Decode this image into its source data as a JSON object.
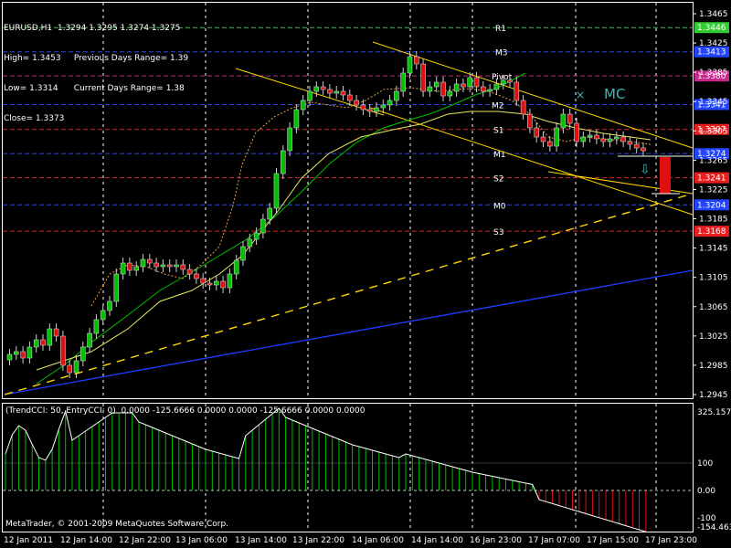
{
  "chart_data": {
    "type": "candlestick",
    "symbol_timeframe": "EURUSD,H1",
    "ohlc_header": "1.3294 1.3295 1.3274 1.3275",
    "price_axis_labels": [
      "1.3465",
      "1.3425",
      "1.3385",
      "1.3345",
      "1.3305",
      "1.3265",
      "1.3225",
      "1.3185",
      "1.3145",
      "1.3105",
      "1.3065",
      "1.3025",
      "1.2985",
      "1.2945"
    ],
    "time_axis_labels": [
      "12 Jan 2011",
      "12 Jan 14:00",
      "12 Jan 22:00",
      "13 Jan 06:00",
      "13 Jan 14:00",
      "13 Jan 22:00",
      "14 Jan 06:00",
      "14 Jan 14:00",
      "16 Jan 23:00",
      "17 Jan 07:00",
      "17 Jan 15:00",
      "17 Jan 23:00"
    ],
    "pivot_levels": [
      {
        "label": "R1",
        "price": "1.3446",
        "color": "#32cd32"
      },
      {
        "label": "M3",
        "price": "1.3413",
        "color": "#2244ff"
      },
      {
        "label": "Pivot",
        "price": "1.3380",
        "color": "#c8288c"
      },
      {
        "label": "M2",
        "price": "1.3341",
        "color": "#2244ff"
      },
      {
        "label": "S1",
        "price": "1.3307",
        "color": "#e61e1e"
      },
      {
        "label": "M1",
        "price": "1.3274",
        "color": "#2244ff"
      },
      {
        "label": "S2",
        "price": "1.3241",
        "color": "#e61e1e"
      },
      {
        "label": "M0",
        "price": "1.3204",
        "color": "#2244ff"
      },
      {
        "label": "S3",
        "price": "1.3168",
        "color": "#e61e1e"
      }
    ],
    "info": {
      "high": "High= 1.3453",
      "low": "Low= 1.3314",
      "close": "Close= 1.3373",
      "prev_range": "Previous Days Range= 1.39",
      "cur_range": "Current Days Range= 1.38"
    },
    "annotation": "MC",
    "indicator": {
      "label": "(TrendCCI: 50, EntryCCI: 0)  0.0000 -125.6666 0.0000 0.0000 -125.6666 0.0000 0.0000",
      "axis_labels": [
        "325.1572",
        "100",
        "0.00",
        "-100",
        "-154.463"
      ]
    },
    "colors": {
      "bull": "#00c000",
      "bear": "#e01010",
      "grid": "#ffffff",
      "ma_fast": "#e8e860",
      "ma_slow": "#00c000",
      "trendline": "#ffd700",
      "long_trend": "#1e3cff",
      "hist_up": "#00c000",
      "hist_down": "#e01010"
    }
  },
  "footer": {
    "copyright": "MetaTrader, © 2001-2009 MetaQuotes Software Corp."
  }
}
